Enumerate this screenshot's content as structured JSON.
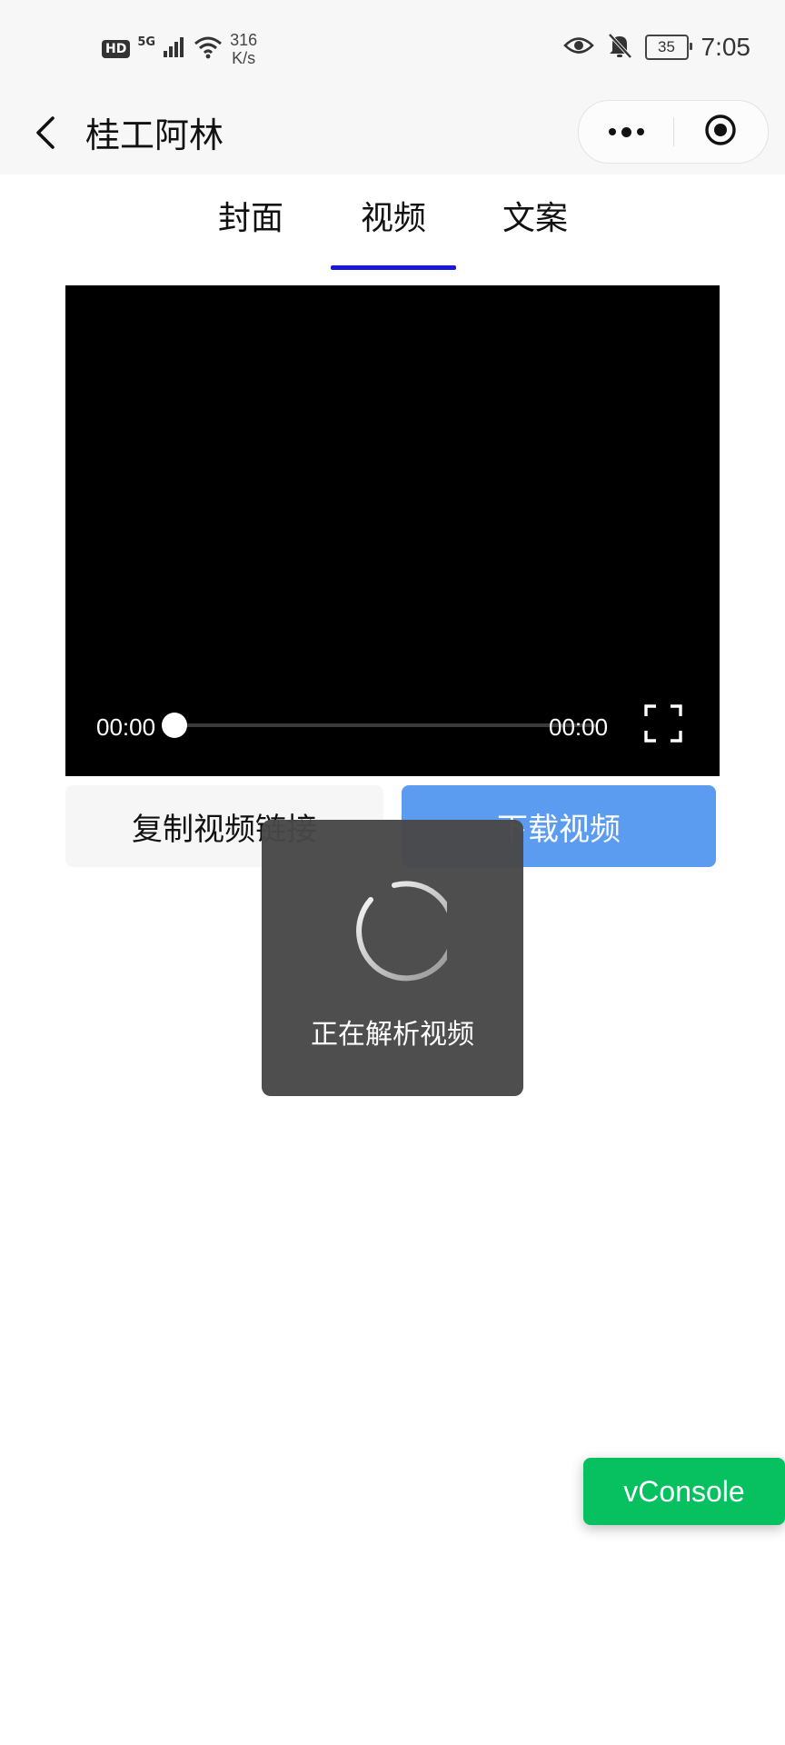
{
  "status_bar": {
    "hd_badge": "HD",
    "network": "5G",
    "speed_value": "316",
    "speed_unit": "K/s",
    "battery_level": "35",
    "time": "7:05",
    "icons": [
      "signal-icon",
      "wifi-icon",
      "eye-icon",
      "mute-bell-icon",
      "battery-icon"
    ]
  },
  "nav": {
    "title": "桂工阿林",
    "icons": [
      "back-arrow-icon",
      "more-dots-icon",
      "target-close-icon"
    ]
  },
  "tabs": [
    {
      "label": "封面",
      "active": false
    },
    {
      "label": "视频",
      "active": true
    },
    {
      "label": "文案",
      "active": false
    }
  ],
  "video_player": {
    "current_time": "00:00",
    "duration": "00:00",
    "progress": 0,
    "icons": [
      "fullscreen-icon"
    ]
  },
  "actions": {
    "copy_label": "复制视频链接",
    "download_label": "下载视频"
  },
  "toast": {
    "message": "正在解析视频",
    "icon": "loading-spinner-icon"
  },
  "vconsole": {
    "label": "vConsole"
  },
  "colors": {
    "tab_underline": "#1a1ad6",
    "download_button": "#5b9cf0",
    "vconsole_button": "#07c160",
    "toast_background": "#484848"
  }
}
